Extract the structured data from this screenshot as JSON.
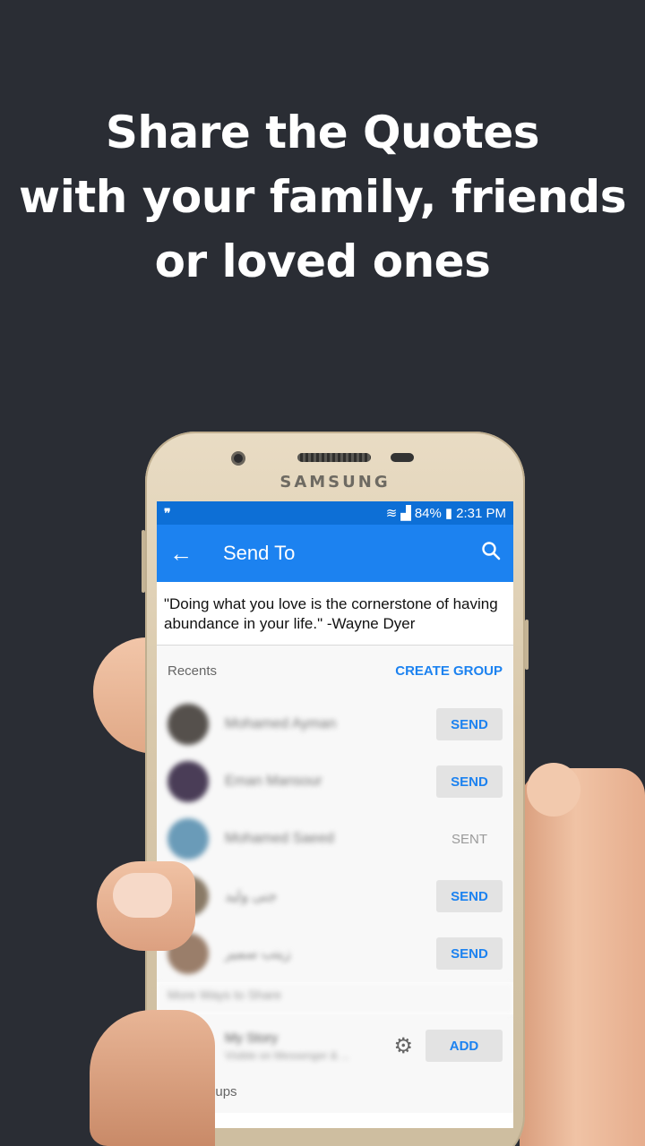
{
  "headline": {
    "line1": "Share the Quotes",
    "line2": "with your family, friends",
    "line3": "or loved ones"
  },
  "phone": {
    "brand": "SAMSUNG"
  },
  "status_bar": {
    "left_icon": "quote-mark-icon",
    "battery": "84%",
    "time": "2:31 PM"
  },
  "app_bar": {
    "title": "Send To",
    "back_icon": "arrow-left-icon",
    "search_icon": "search-icon"
  },
  "quote": {
    "text": "\"Doing what you love is the cornerstone of having abundance in your life.\" -Wayne Dyer"
  },
  "recents": {
    "label": "Recents",
    "action": "CREATE GROUP",
    "contacts": [
      {
        "name": "Mohamed Ayman",
        "button": "SEND",
        "avatar_color": "#55504c"
      },
      {
        "name": "Eman Mansour",
        "button": "SEND",
        "avatar_color": "#4a3d57"
      },
      {
        "name": "Mohamed Saeed",
        "button": "SENT",
        "avatar_color": "#6a9bb8"
      },
      {
        "name": "جنى وليد",
        "button": "SEND",
        "avatar_color": "#8a7a66"
      },
      {
        "name": "زينب سمير",
        "button": "SEND",
        "avatar_color": "#9a7e6a"
      }
    ]
  },
  "more_ways": {
    "label": "More Ways to Share"
  },
  "story": {
    "title": "My Story",
    "subtitle": "Visible on Messenger & ...",
    "button": "ADD",
    "avatar_color": "#5b6e70",
    "gear_icon": "gear-icon"
  },
  "top_groups": {
    "label": "Top Groups"
  },
  "colors": {
    "accent": "#1c82f0",
    "background": "#2a2d34"
  }
}
